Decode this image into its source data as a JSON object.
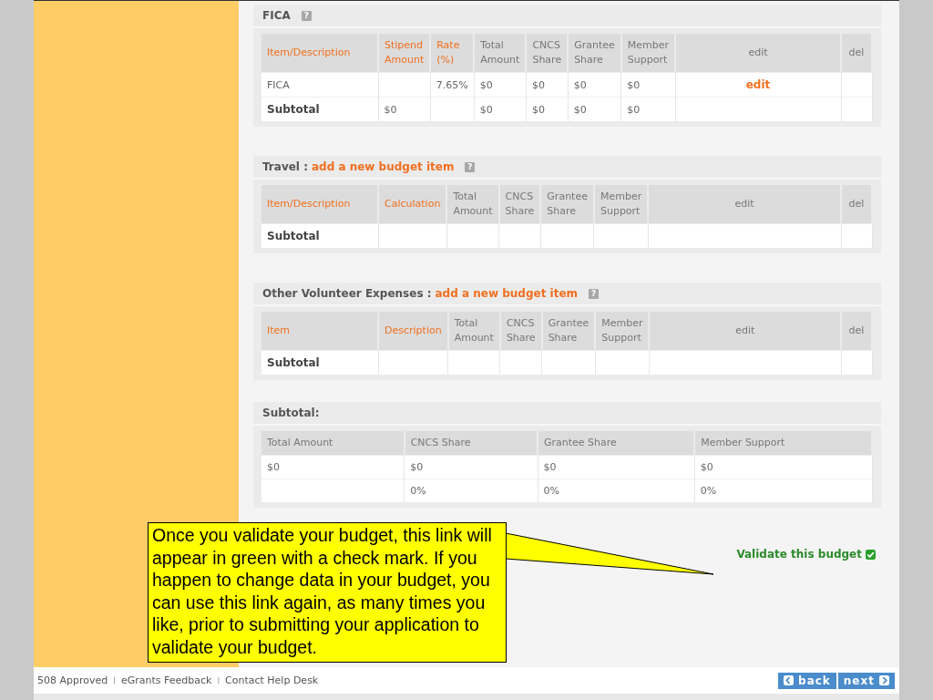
{
  "sections": [
    {
      "title": "FICA",
      "help": "?",
      "kind": "budget",
      "columns": [
        {
          "label": "Item/Description",
          "kind": "sortable"
        },
        {
          "label": "Stipend Amount",
          "kind": "sortable"
        },
        {
          "label": "Rate (%)",
          "kind": "sortable"
        },
        {
          "label": "Total Amount",
          "kind": "plain"
        },
        {
          "label": "CNCS Share",
          "kind": "plain"
        },
        {
          "label": "Grantee Share",
          "kind": "plain"
        },
        {
          "label": "Member Support",
          "kind": "plain"
        },
        {
          "label": "edit",
          "kind": "action"
        },
        {
          "label": "del",
          "kind": "action"
        }
      ],
      "rows": [
        {
          "kind": "item",
          "cells": [
            "FICA",
            null,
            "7.65%",
            "$0",
            "$0",
            "$0",
            "$0",
            "edit",
            null
          ]
        },
        {
          "kind": "subtotal",
          "cells": [
            "Subtotal",
            "$0",
            null,
            "$0",
            "$0",
            "$0",
            "$0",
            null,
            null
          ]
        }
      ]
    },
    {
      "title": "Travel :",
      "link": "add a new budget item",
      "help": "?",
      "kind": "budget",
      "columns": [
        {
          "label": "Item/Description",
          "kind": "sortable"
        },
        {
          "label": "Calculation",
          "kind": "sortable"
        },
        {
          "label": "Total Amount",
          "kind": "plain"
        },
        {
          "label": "CNCS Share",
          "kind": "plain"
        },
        {
          "label": "Grantee Share",
          "kind": "plain"
        },
        {
          "label": "Member Support",
          "kind": "plain"
        },
        {
          "label": "edit",
          "kind": "action"
        },
        {
          "label": "del",
          "kind": "action"
        }
      ],
      "rows": [
        {
          "kind": "subtotal",
          "cells": [
            "Subtotal",
            null,
            null,
            null,
            null,
            null,
            null,
            null
          ]
        }
      ]
    },
    {
      "title": "Other Volunteer Expenses :",
      "link": "add a new budget item",
      "help": "?",
      "kind": "budget",
      "columns": [
        {
          "label": "Item",
          "kind": "sortable"
        },
        {
          "label": "Description",
          "kind": "sortable"
        },
        {
          "label": "Total Amount",
          "kind": "plain"
        },
        {
          "label": "CNCS Share",
          "kind": "plain"
        },
        {
          "label": "Grantee Share",
          "kind": "plain"
        },
        {
          "label": "Member Support",
          "kind": "plain"
        },
        {
          "label": "edit",
          "kind": "action"
        },
        {
          "label": "del",
          "kind": "action"
        }
      ],
      "rows": [
        {
          "kind": "subtotal",
          "cells": [
            "Subtotal",
            null,
            null,
            null,
            null,
            null,
            null,
            null
          ]
        }
      ]
    },
    {
      "title": "Subtotal:",
      "kind": "summary",
      "columns": [
        {
          "label": "Total Amount",
          "kind": "plain"
        },
        {
          "label": "CNCS Share",
          "kind": "plain"
        },
        {
          "label": "Grantee Share",
          "kind": "plain"
        },
        {
          "label": "Member Support",
          "kind": "plain"
        }
      ],
      "rows": [
        {
          "kind": "item",
          "cells": [
            "$0",
            "$0",
            "$0",
            "$0"
          ]
        },
        {
          "kind": "item",
          "cells": [
            null,
            "0%",
            "0%",
            "0%"
          ]
        }
      ]
    }
  ],
  "validate": {
    "label": "Validate this budget",
    "validated": true
  },
  "callout": {
    "text": "Once you validate your budget, this link will appear in green with a check mark. If you happen to change data in your budget, you can use this link again, as many times you like, prior to submitting your application to validate your budget."
  },
  "footer": {
    "items": [
      {
        "kind": "link",
        "text": "508 Approved"
      },
      {
        "kind": "separator",
        "text": "I"
      },
      {
        "kind": "link",
        "text": "eGrants Feedback"
      },
      {
        "kind": "separator",
        "text": "I"
      },
      {
        "kind": "link",
        "text": "Contact Help Desk"
      }
    ],
    "buttons": [
      {
        "label": "back",
        "kind": "back"
      },
      {
        "label": "next",
        "kind": "next"
      }
    ]
  }
}
